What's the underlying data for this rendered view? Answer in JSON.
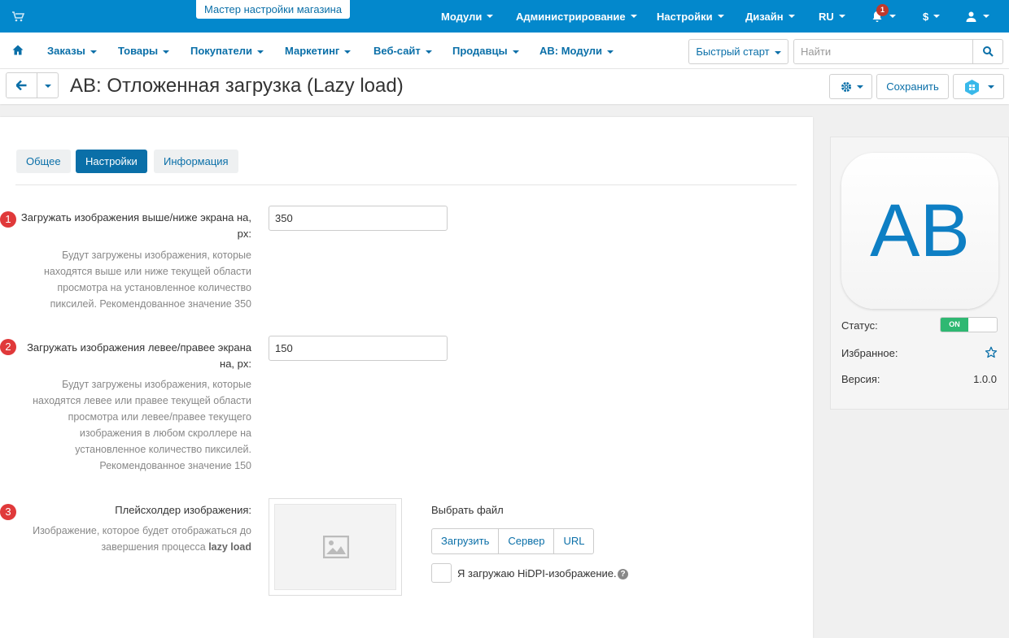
{
  "topbar": {
    "wizard": "Мастер настройки магазина",
    "menu": [
      "Модули",
      "Администрирование",
      "Настройки",
      "Дизайн",
      "RU",
      "$"
    ],
    "notification_count": "1",
    "cart_icon": "cart-icon",
    "bell_icon": "bell-icon",
    "user_icon": "user-icon"
  },
  "navbar": {
    "home_icon": "home-icon",
    "items": [
      "Заказы",
      "Товары",
      "Покупатели",
      "Маркетинг",
      "Веб-сайт",
      "Продавцы",
      "AB: Модули"
    ],
    "quickstart": "Быстрый старт",
    "search_placeholder": "Найти"
  },
  "titlebar": {
    "title": "AB: Отложенная загрузка (Lazy load)",
    "save": "Сохранить"
  },
  "tabs": [
    "Общее",
    "Настройки",
    "Информация"
  ],
  "active_tab": "Настройки",
  "fields": [
    {
      "number": "1",
      "label_line1": "Загружать изображения выше/ниже экрана на,",
      "label_line2": "px:",
      "help": [
        "Будут загружены изображения, которые",
        "находятся выше или ниже текущей области",
        "просмотра на установленное количество",
        "пиксилей. Рекомендованное значение 350"
      ],
      "value": "350"
    },
    {
      "number": "2",
      "label_line1": "Загружать изображения левее/правее экрана",
      "label_line2": "на, px:",
      "help": [
        "Будут загружены изображения, которые",
        "находятся левее или правее текущей области",
        "просмотра или левее/правее текущего",
        "изображения в любом скроллере на",
        "установленное количество пиксилей.",
        "Рекомендованное значение 150"
      ],
      "value": "150"
    },
    {
      "number": "3",
      "label_line1": "Плейсхолдер изображения:",
      "help_prefix_1": "Изображение, которое будет отображаться до",
      "help_prefix_2": "завершения процесса ",
      "help_bold": "lazy load"
    }
  ],
  "upload": {
    "choose_file": "Выбрать файл",
    "buttons": [
      "Загрузить",
      "Сервер",
      "URL"
    ],
    "hidpi": "Я загружаю HiDPI-изображение.",
    "help_icon": "?"
  },
  "sidebar": {
    "logo_text": "AB",
    "status_label": "Статус:",
    "status_value": "ON",
    "favorite_label": "Избранное:",
    "version_label": "Версия:",
    "version_value": "1.0.0"
  },
  "colors": {
    "topbar": "#0388cc",
    "link": "#0a6fa8",
    "badge": "#e0393a",
    "toggle_on": "#2eb872"
  }
}
